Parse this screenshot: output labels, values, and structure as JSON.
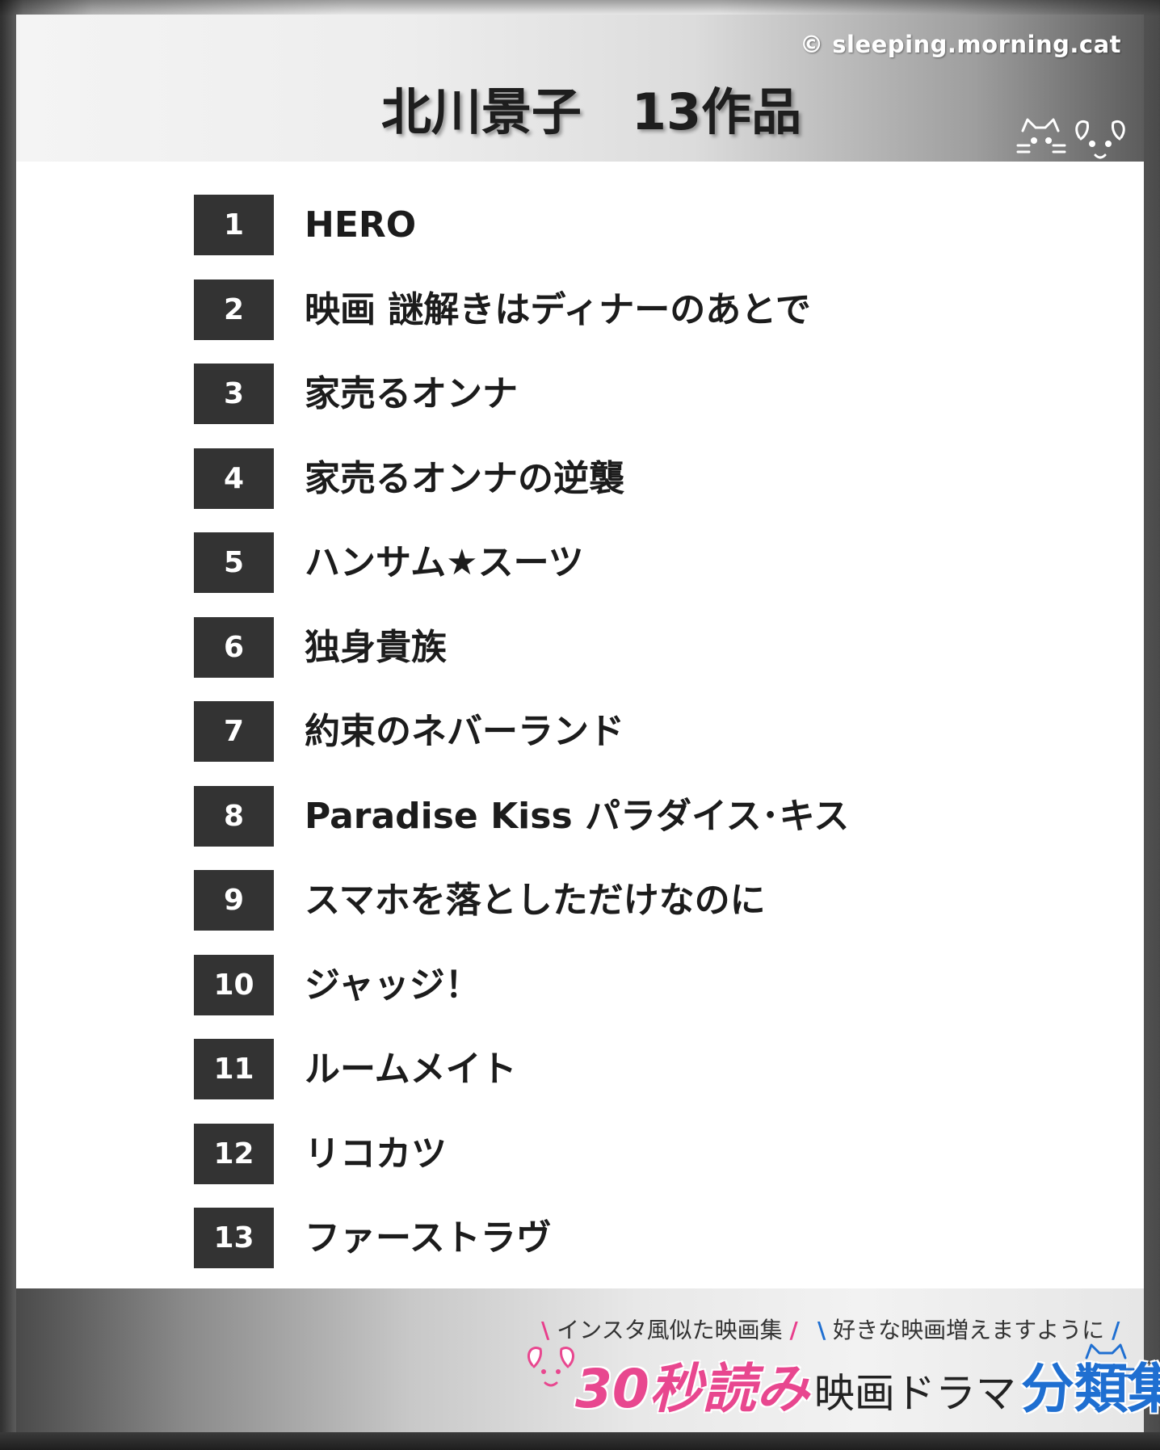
{
  "header": {
    "credit": "© sleeping.morning.cat",
    "title": "北川景子　13作品"
  },
  "list": [
    {
      "num": "1",
      "name": "HERO"
    },
    {
      "num": "2",
      "name": "映画 謎解きはディナーのあとで"
    },
    {
      "num": "3",
      "name": "家売るオンナ"
    },
    {
      "num": "4",
      "name": "家売るオンナの逆襲"
    },
    {
      "num": "5",
      "name": "ハンサム★スーツ"
    },
    {
      "num": "6",
      "name": "独身貴族"
    },
    {
      "num": "7",
      "name": "約束のネバーランド"
    },
    {
      "num": "8",
      "name": "Paradise Kiss パラダイス･キス"
    },
    {
      "num": "9",
      "name": "スマホを落としただけなのに"
    },
    {
      "num": "10",
      "name": "ジャッジ！"
    },
    {
      "num": "11",
      "name": "ルームメイト"
    },
    {
      "num": "12",
      "name": "リコカツ"
    },
    {
      "num": "13",
      "name": "ファーストラヴ"
    }
  ],
  "footer": {
    "tagline_left": "インスタ風似た映画集",
    "tagline_right": "好きな映画増えますように",
    "brand_pink": "30秒読み",
    "brand_mid": "映画ドラマ",
    "brand_blue": "分類集"
  },
  "colors": {
    "number_box": "#333333",
    "brand_pink": "#e8478f",
    "brand_blue": "#1f6fd1"
  },
  "icons": [
    "cat-face-icon",
    "dog-face-icon"
  ]
}
